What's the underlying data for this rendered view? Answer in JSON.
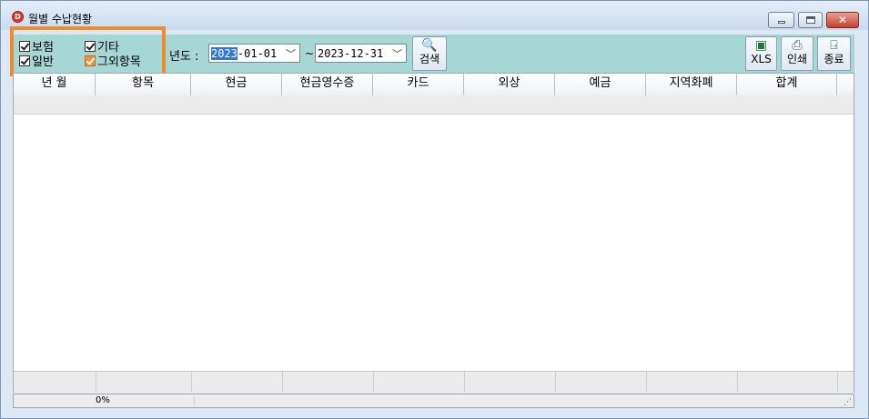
{
  "window": {
    "title": "월별 수납현황",
    "app_icon": "D"
  },
  "filters": {
    "checkboxes": [
      {
        "label": "보험",
        "checked": true,
        "highlighted": false
      },
      {
        "label": "기타",
        "checked": true,
        "highlighted": false
      },
      {
        "label": "일반",
        "checked": true,
        "highlighted": false
      },
      {
        "label": "그외항목",
        "checked": true,
        "highlighted": true
      }
    ],
    "year_label": "년도 :",
    "date_from_selected": "2023",
    "date_from_rest": "-01-01",
    "date_separator": "~",
    "date_to": "2023-12-31",
    "search_label": "검색"
  },
  "toolbar": {
    "xls_label": "XLS",
    "print_label": "인쇄",
    "exit_label": "종료"
  },
  "grid": {
    "columns": [
      "년 월",
      "항목",
      "현금",
      "현금영수증",
      "카드",
      "외상",
      "예금",
      "지역화폐",
      "합계"
    ]
  },
  "status": {
    "progress_text": "0%",
    "progress": 0
  },
  "colors": {
    "toolbar_bg": "#a7d7d4",
    "highlight": "#f08a2c"
  }
}
